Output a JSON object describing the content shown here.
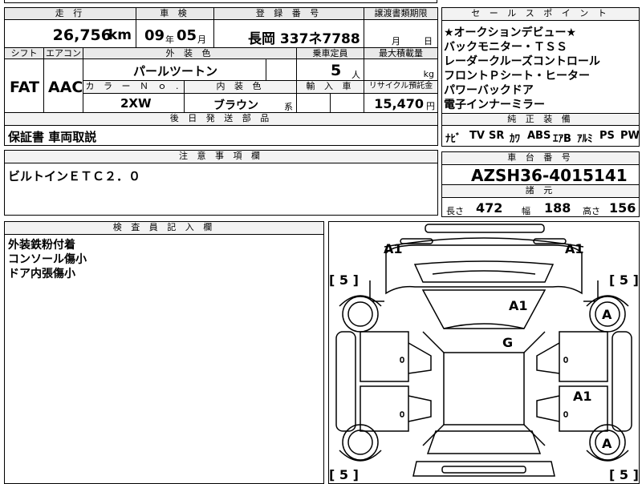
{
  "top": {
    "mileage_label": "走 行",
    "mileage_value": "26,756",
    "mileage_unit": "km",
    "inspection_label": "車 検",
    "inspection_year": "09",
    "inspection_year_unit": "年",
    "inspection_month": "05",
    "inspection_month_unit": "月",
    "plate_label": "登 録 番 号",
    "plate_value": "長岡 337ネ7788",
    "transfer_label": "譲渡書類期限",
    "transfer_month_unit": "月",
    "transfer_day_unit": "日"
  },
  "row2": {
    "shift_label": "シフト",
    "aircon_label": "エアコン",
    "exterior_label": "外 装 色",
    "capacity_label": "乗車定員",
    "maxload_label": "最大積載量",
    "shift_value": "FAT",
    "aircon_value": "AAC",
    "exterior_value": "パールツートン",
    "capacity_value": "5",
    "capacity_unit": "人",
    "maxload_unit": "kg",
    "colorno_label": "カ ラ ー Ｎ ｏ .",
    "interior_label": "内 装 色",
    "import_label": "輸 入 車",
    "recycle_label": "リサイクル預託金",
    "colorno_value": "2XW",
    "interior_value": "ブラウン",
    "interior_suffix": "系",
    "recycle_value": "15,470",
    "recycle_unit": "円"
  },
  "later_parts": {
    "label": "後 日 発 送 部 品",
    "value": "保証書 車両取説"
  },
  "notes": {
    "label": "注 意 事 項 欄",
    "value": "ビルトインＥＴＣ２．０"
  },
  "inspector": {
    "label": "検 査 員 記 入 欄",
    "lines": [
      "外装鉄粉付着",
      "コンソール傷小",
      "ドア内張傷小"
    ]
  },
  "sales_points": {
    "label": "セ ー ル ス ポ イ ン ト",
    "lines": [
      "★オークションデビュー★",
      "バックモニター・ＴＳＳ",
      "レーダークルーズコントロール",
      "フロントＰシート・ヒーター",
      "パワーバックドア",
      "電子インナーミラー"
    ]
  },
  "equipment": {
    "label": "純 正 装 備",
    "items": [
      "ﾅﾋﾞ",
      "TV",
      "SR",
      "ｶﾜ",
      "ABS",
      "ｴｱB",
      "ｱﾙﾐ",
      "PS",
      "PW"
    ]
  },
  "chassis": {
    "label": "車 台 番 号",
    "value": "AZSH36-4015141"
  },
  "specs": {
    "label": "諸 元",
    "length_label": "長さ",
    "length_value": "472",
    "width_label": "幅",
    "width_value": "188",
    "height_label": "高さ",
    "height_value": "156"
  },
  "diagram": {
    "marks": {
      "front_left": "A1",
      "front_right": "A1",
      "hood": "A1",
      "windshield": "G",
      "right_wheel_front": "A",
      "right_door": "A1",
      "right_wheel_rear": "A"
    },
    "brackets": {
      "tl": "[ 5 ]",
      "tr": "[ 5 ]",
      "bl": "[ 5 ]",
      "br": "[ 5 ]"
    }
  }
}
